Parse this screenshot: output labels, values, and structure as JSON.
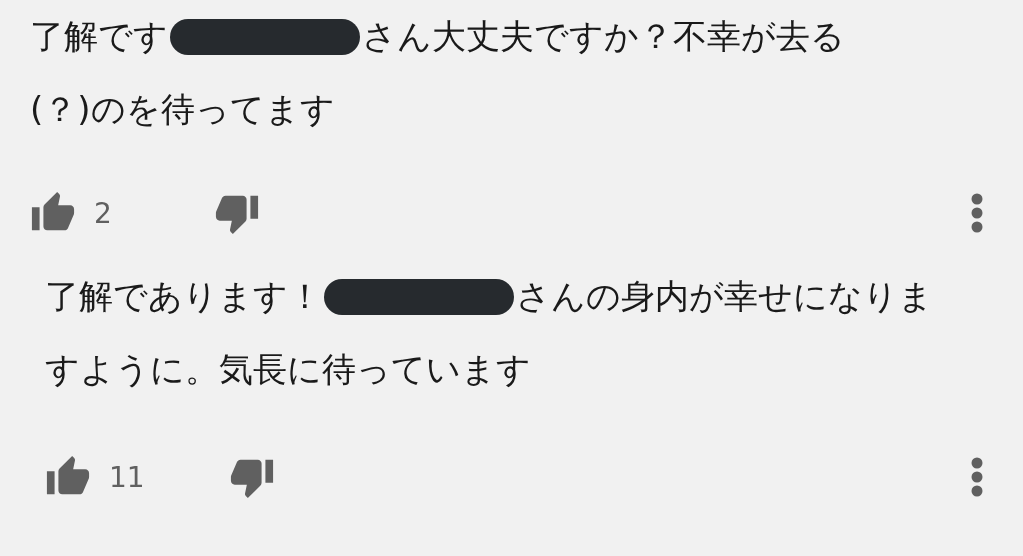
{
  "comments": [
    {
      "lines": [
        {
          "before": "了解です",
          "redacted": true,
          "after": "さん大丈夫ですか？不幸が去る"
        },
        {
          "before": "(？)のを待ってます"
        }
      ],
      "likes": "2"
    },
    {
      "lines": [
        {
          "before": "了解であります！",
          "redacted": true,
          "after": "さんの身内が幸せになりま"
        },
        {
          "before": "すように。気長に待っています"
        }
      ],
      "likes": "11"
    }
  ]
}
